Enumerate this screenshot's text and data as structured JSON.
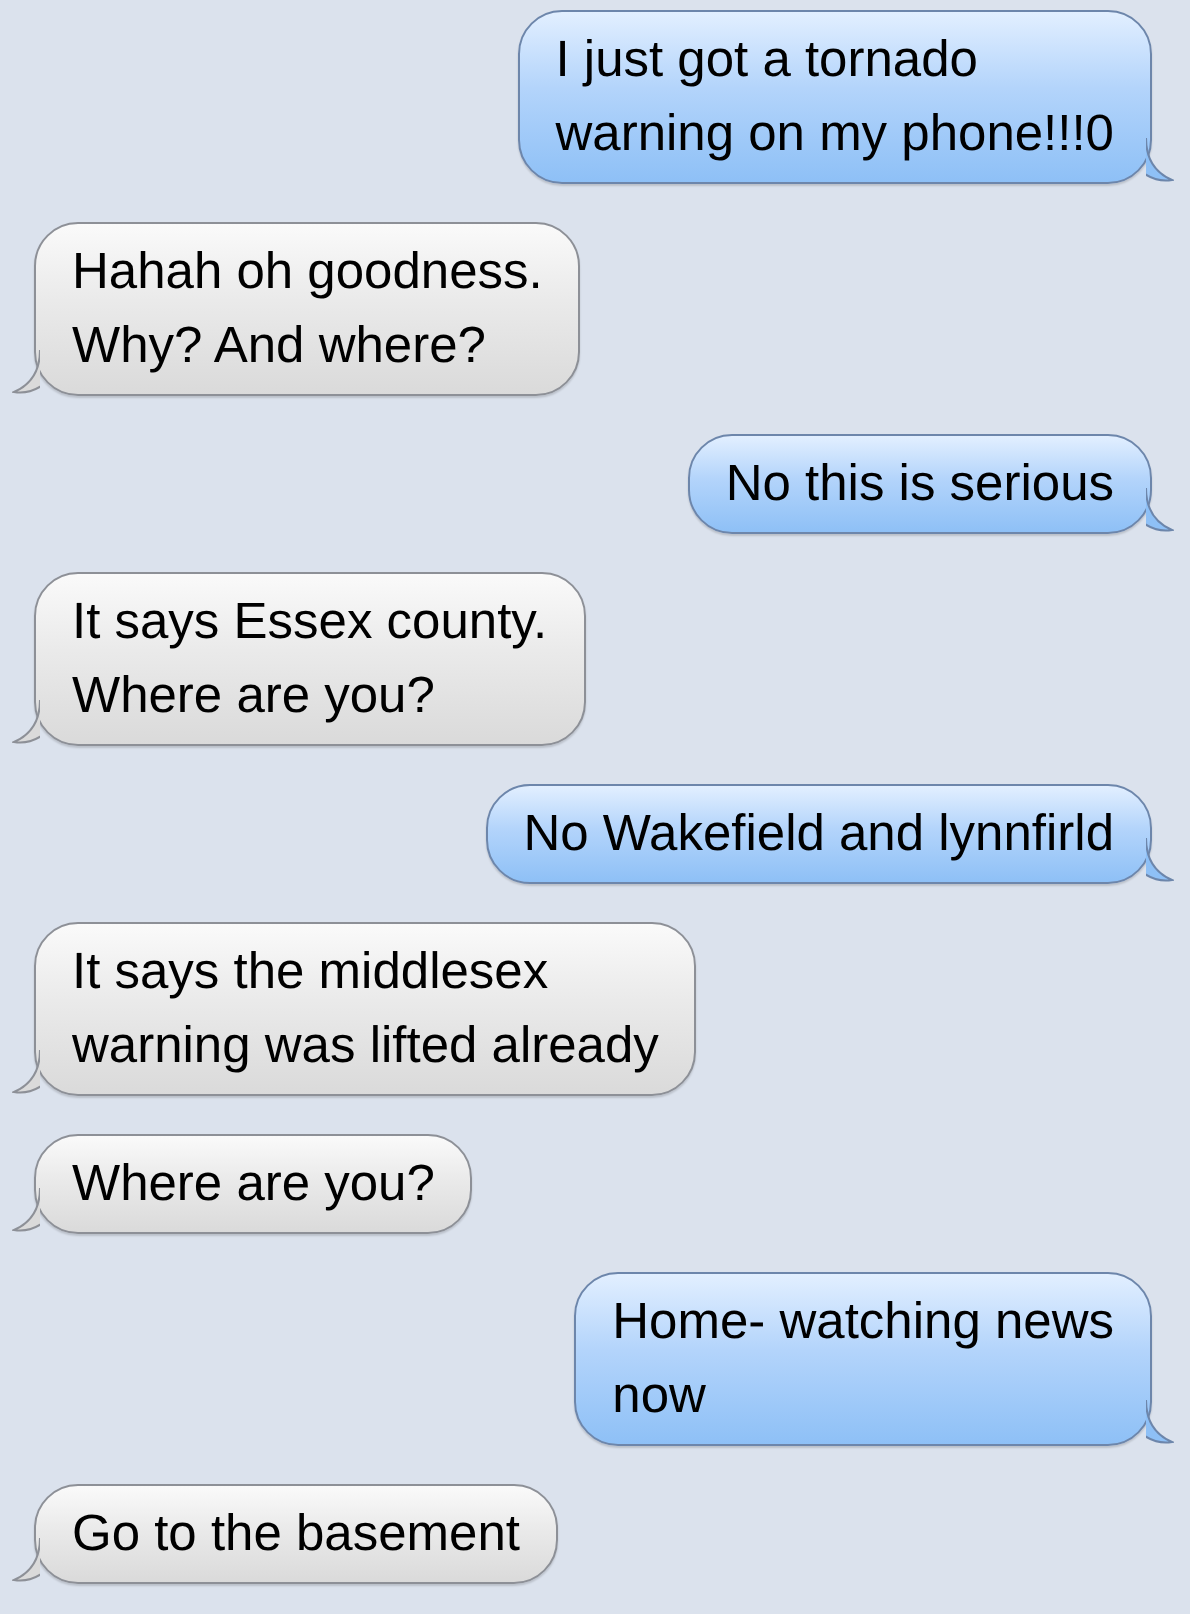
{
  "messages": [
    {
      "kind": "sent",
      "text": "I just got a tornado\nwarning on my phone!!!0"
    },
    {
      "kind": "received",
      "text": "Hahah oh goodness.\nWhy? And where?"
    },
    {
      "kind": "sent",
      "text": "No this is serious"
    },
    {
      "kind": "received",
      "text": "It says Essex county.\nWhere are you?"
    },
    {
      "kind": "sent",
      "text": "No Wakefield and lynnfirld"
    },
    {
      "kind": "received",
      "text": "It says the middlesex\nwarning was lifted already"
    },
    {
      "kind": "received",
      "text": "Where are you?"
    },
    {
      "kind": "sent",
      "text": "Home- watching news\nnow"
    },
    {
      "kind": "received",
      "text": "Go to the basement"
    }
  ]
}
